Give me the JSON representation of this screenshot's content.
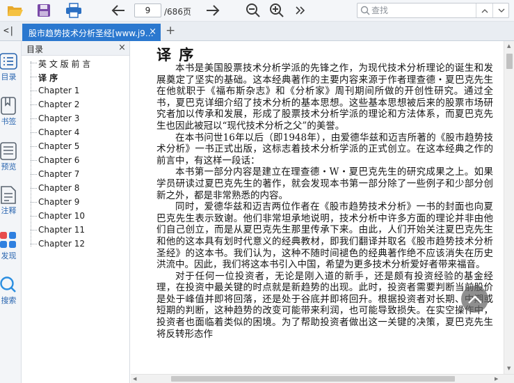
{
  "toolbar": {
    "page_current": "9",
    "page_total": "/686页",
    "search_placeholder": "查找"
  },
  "tab": {
    "title": "股市趋势技术分析圣经[www.j9…",
    "close": "×",
    "add": "+"
  },
  "rail": {
    "collapse": "<|",
    "items": [
      {
        "label": "目录",
        "icon": "list-icon"
      },
      {
        "label": "书签",
        "icon": "bookmark-icon"
      },
      {
        "label": "预览",
        "icon": "preview-icon"
      },
      {
        "label": "注释",
        "icon": "annotation-icon"
      },
      {
        "label": "发现",
        "icon": "discover-icon"
      },
      {
        "label": "搜索",
        "icon": "search-icon"
      }
    ]
  },
  "toc": {
    "title": "目录",
    "close": "×",
    "items": [
      "英 文 版 前 言",
      "译 序",
      "Chapter 1",
      "Chapter 2",
      "Chapter 3",
      "Chapter 4",
      "Chapter 5",
      "Chapter 6",
      "Chapter 7",
      "Chapter 8",
      "Chapter 9",
      "Chapter 10",
      "Chapter 11",
      "Chapter 12"
    ],
    "active": "译 序"
  },
  "document": {
    "title": "译 序",
    "paragraphs": [
      "本书是美国股票技术分析学派的先锋之作，为现代技术分析理论的诞生和发展奠定了坚实的基础。这本经典著作的主要内容来源于作者理查德・夏巴克先生在他就职于《福布斯杂志》和《分析家》周刊期间所做的开创性研究。通过全书，夏巴克详细介绍了技术分析的基本思想。这些基本思想被后来的股票市场研究者加以传承和发展，形成了股票技术分析学派的理论和方法体系，而夏巴克先生也因此被冠以“现代技术分析之父”的美誉。",
      "在本书问世16年以后（即1948年），由爱德华兹和迈吉所著的《股市趋势技术分析》一书正式出版，这标志着技术分析学派的正式创立。在这本经典之作的前言中，有这样一段话：",
      "本书第一部分内容是建立在理查德・W・夏巴克先生的研究成果之上。如果学员研读过夏巴克先生的著作，就会发现本书第一部分除了一些例子和少部分创新之外，都是非常熟悉的内容。",
      "同时，爱德华兹和迈吉两位作者在《股市趋势技术分析》一书的封面也向夏巴克先生表示致谢。他们非常坦承地说明，技术分析中许多方面的理论并非由他们自己创立，而是从夏巴克先生那里传承下来。由此，人们开始关注夏巴克先生和他的这本具有划时代意义的经典教材，即我们翻译并取名《股市趋势技术分析圣经》的这本书。我们认为，这种不随时间褪色的经典著作绝不应该消失在历史洪流中。因此，我们将这本书引入中国，希望为更多技术分析爱好者带来福音。",
      "对于任何一位投资者，无论是刚入道的新手，还是颇有投资经验的基金经理，在投资中最关键的时点就是新趋势的出现。此时，投资者需要判断当前股价是处于峰值并即将回落，还是处于谷底并即将回升。根据投资者对长期、中期或短期的判断，这种趋势的改变可能带来利润，也可能导致损失。在实空操作中，投资者也面临着类似的困境。为了帮助投资者做出这一关键的决策，夏巴克先生将反转形态作"
    ]
  }
}
